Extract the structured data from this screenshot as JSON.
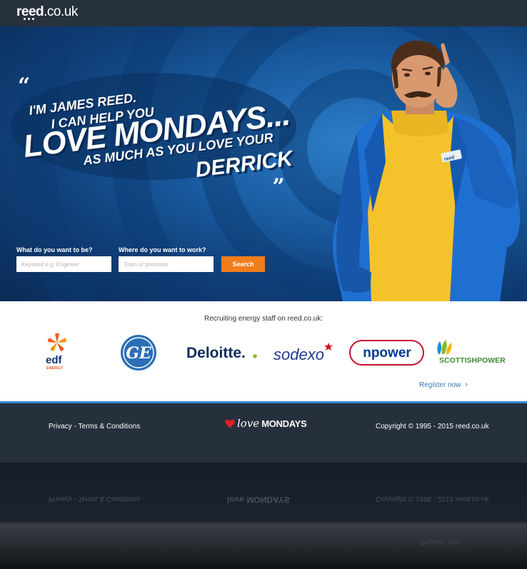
{
  "header": {
    "logo_main": "reed",
    "logo_suffix": ".co.uk"
  },
  "hero": {
    "quote_open": "“",
    "quote_close": "„",
    "line1": "I'M JAMES REED.",
    "line2": "I CAN HELP YOU",
    "line3": "LOVE MONDAYS...",
    "line4": "AS MUCH AS YOU LOVE YOUR",
    "line5": "DERRICK",
    "badge_text": "reed"
  },
  "search": {
    "what_label": "What do you want to be?",
    "what_placeholder": "Keyword e.g. Engineer",
    "where_label": "Where do you want to work?",
    "where_placeholder": "Town or postcode",
    "button_label": "Search"
  },
  "clients": {
    "heading": "Recruiting energy staff on reed.co.uk:",
    "logos": [
      {
        "name": "EDF Energy",
        "text_main": "edf",
        "text_sub": "ENERGY"
      },
      {
        "name": "GE",
        "text_main": "GE"
      },
      {
        "name": "Deloitte",
        "text_main": "Deloitte."
      },
      {
        "name": "Sodexo",
        "text_main": "sodexo"
      },
      {
        "name": "npower",
        "text_main": "npower"
      },
      {
        "name": "ScottishPower",
        "text_main": "SCOTTISHPOWER"
      }
    ],
    "register_label": "Register now"
  },
  "footer": {
    "privacy_label": "Privacy",
    "separator": " - ",
    "terms_label": "Terms & Conditions",
    "love_label": "love",
    "mondays_label": "MONDAYS",
    "copyright": "Copyright © 1995 - 2015 reed.co.uk"
  },
  "colors": {
    "accent_orange": "#f07d1b",
    "hero_blue": "#1a5da3",
    "footer_bg": "#26303c",
    "link_blue": "#3a78b8",
    "heart_red": "#e31e24"
  }
}
